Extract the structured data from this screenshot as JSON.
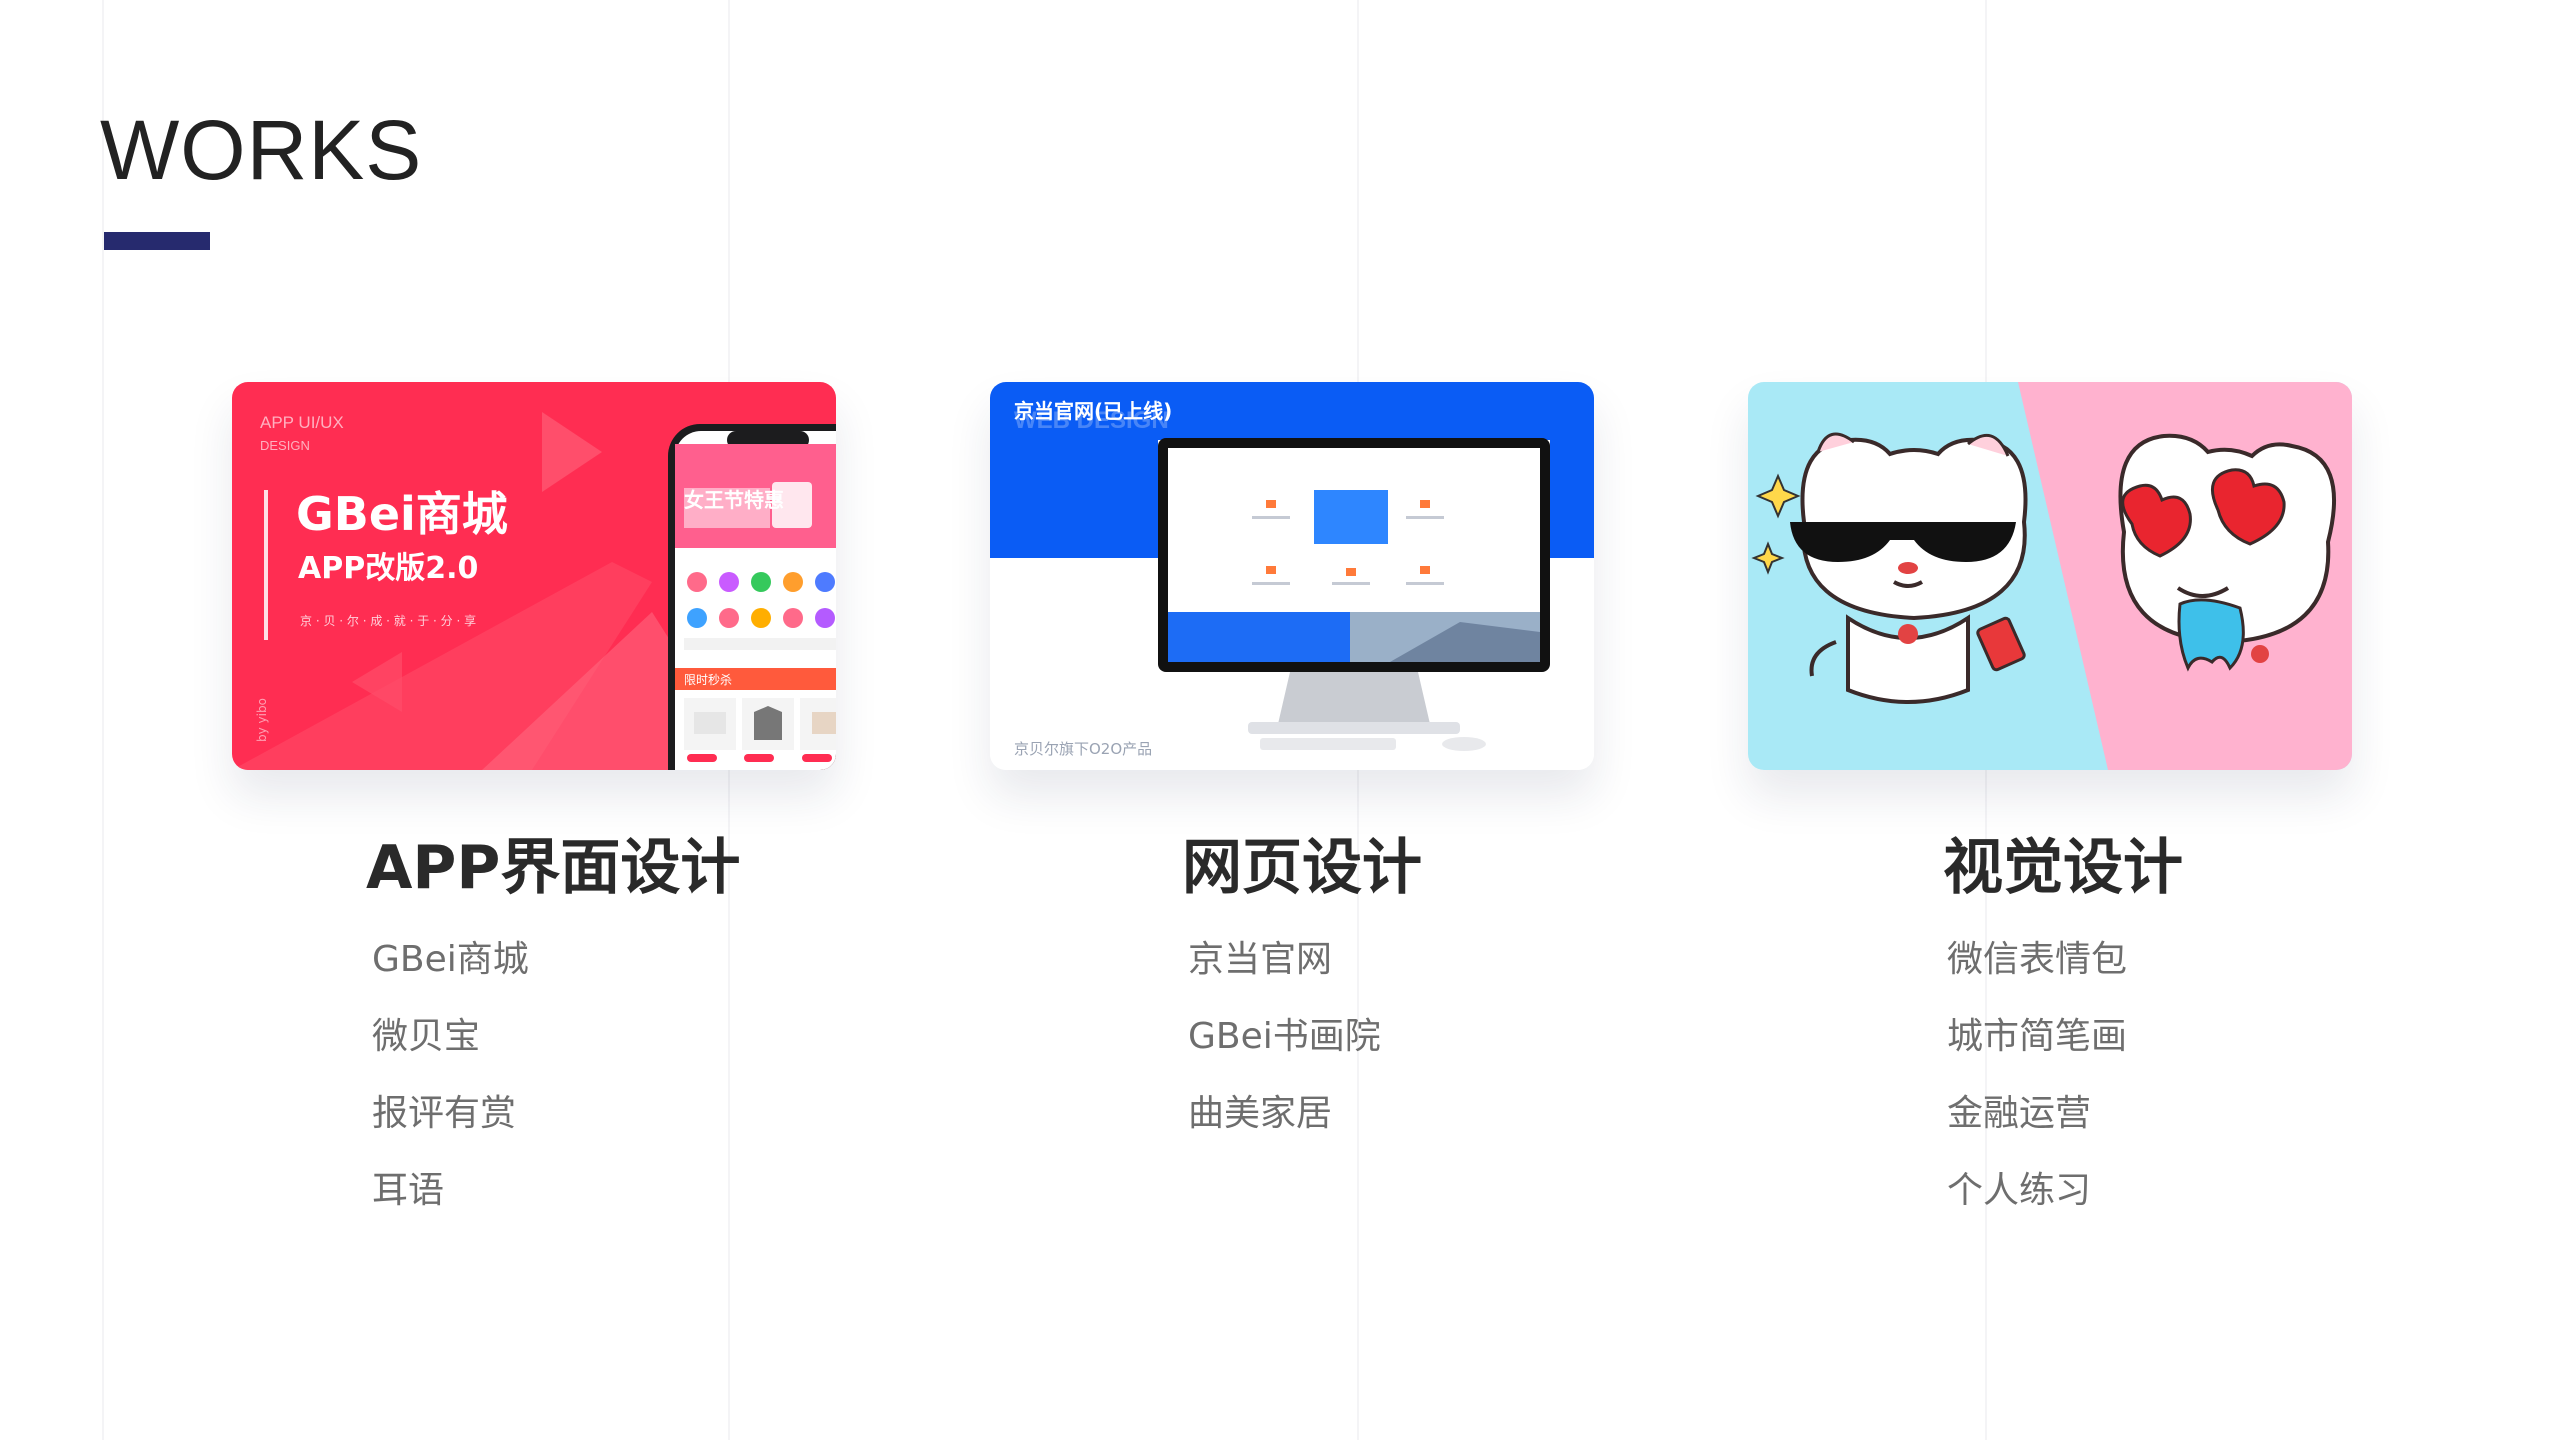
{
  "page": {
    "title": "WORKS",
    "accent_color": "#262a6e"
  },
  "columns": [
    {
      "heading": "APP界面设计",
      "items": [
        "GBei商城",
        "微贝宝",
        "报评有赏",
        "耳语"
      ],
      "card": {
        "tag_line1": "APP UI/UX",
        "tag_line2": "DESIGN",
        "headline": "GBei商城",
        "subheadline": "APP改版2.0",
        "slogan": "京 · 贝 · 尔 · 成 · 就 · 于 · 分 · 享",
        "credit": "by yibo",
        "phone_banner": "女王节特惠",
        "phone_section": "限时秒杀",
        "colors": {
          "bg": "#ff2d52",
          "bg_light": "#ff5a72"
        }
      }
    },
    {
      "heading": "网页设计",
      "items": [
        "京当官网",
        "GBei书画院",
        "曲美家居"
      ],
      "card": {
        "title": "京当官网(已上线)",
        "watermark": "WEB DESIGN",
        "footer": "京贝尔旗下O2O产品",
        "colors": {
          "bg": "#0a5cf5"
        }
      }
    },
    {
      "heading": "视觉设计",
      "items": [
        "微信表情包",
        "城市简笔画",
        "金融运营",
        "个人练习"
      ],
      "card": {
        "colors": {
          "left": "#a9e9f6",
          "right": "#ffb2cf"
        }
      }
    }
  ]
}
